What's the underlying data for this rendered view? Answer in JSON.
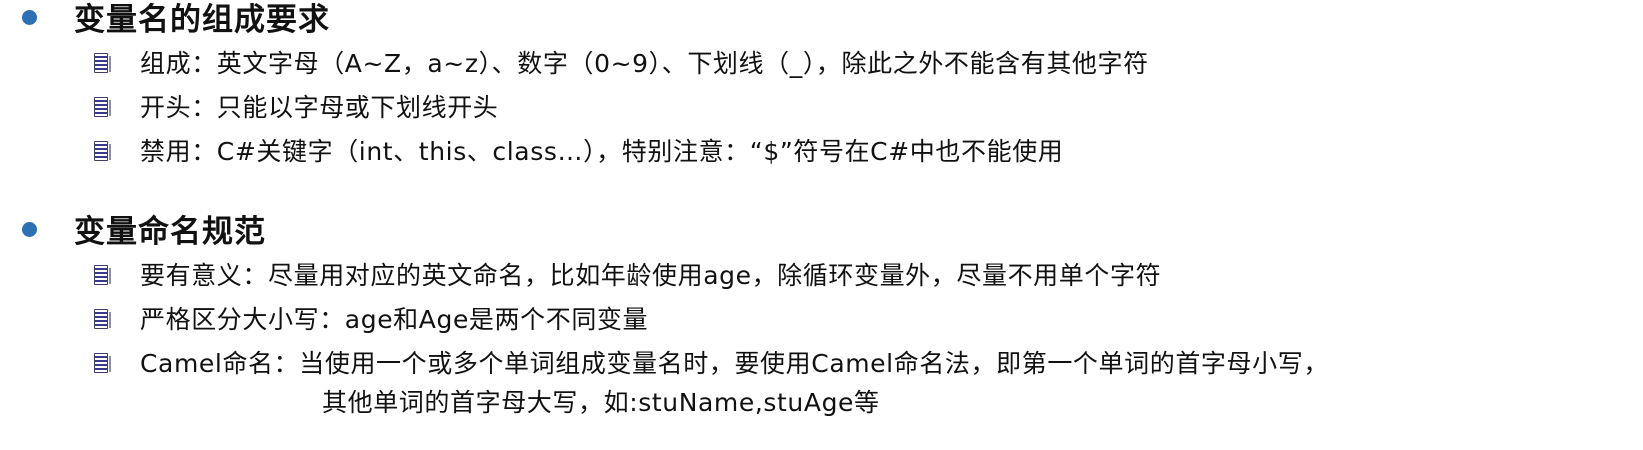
{
  "colors": {
    "bullet": "#2f6fb4",
    "text": "#111111",
    "item_icon": "#3a3a8a"
  },
  "sections": [
    {
      "heading": "变量名的组成要求",
      "items": [
        {
          "text": "组成：英文字母（A~Z，a~z）、数字（0~9）、下划线（_），除此之外不能含有其他字符"
        },
        {
          "text": "开头：只能以字母或下划线开头"
        },
        {
          "text": "禁用：C#关键字（int、this、class…），特别注意：“$”符号在C#中也不能使用"
        }
      ]
    },
    {
      "heading": "变量命名规范",
      "items": [
        {
          "text": "要有意义：尽量用对应的英文命名，比如年龄使用age，除循环变量外，尽量不用单个字符"
        },
        {
          "text": "严格区分大小写：age和Age是两个不同变量"
        },
        {
          "text": "Camel命名：当使用一个或多个单词组成变量名时，要使用Camel命名法，即第一个单词的首字母小写，",
          "continuation": "其他单词的首字母大写，如:stuName,stuAge等"
        }
      ]
    }
  ]
}
